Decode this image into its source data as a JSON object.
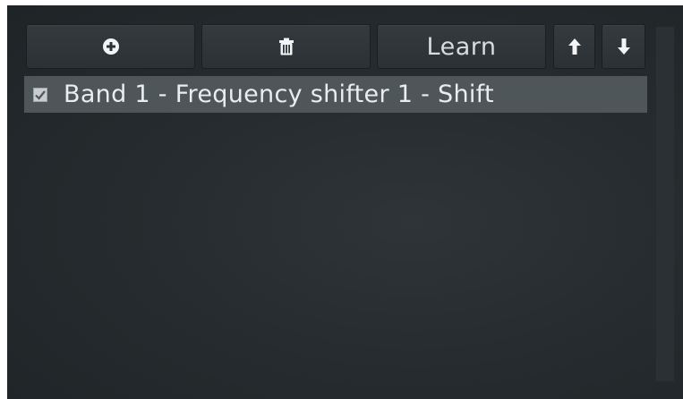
{
  "toolbar": {
    "add_icon": "plus-circle-icon",
    "delete_icon": "trash-icon",
    "learn_label": "Learn",
    "up_icon": "arrow-up-icon",
    "down_icon": "arrow-down-icon"
  },
  "list": {
    "items": [
      {
        "label": "Band 1 - Frequency shifter 1 - Shift",
        "checked": true,
        "selected": true
      }
    ]
  },
  "colors": {
    "panel_bg": "#262c2f",
    "button_bg": "#31373a",
    "selected_row": "#4e5659",
    "text": "#e9edef"
  }
}
